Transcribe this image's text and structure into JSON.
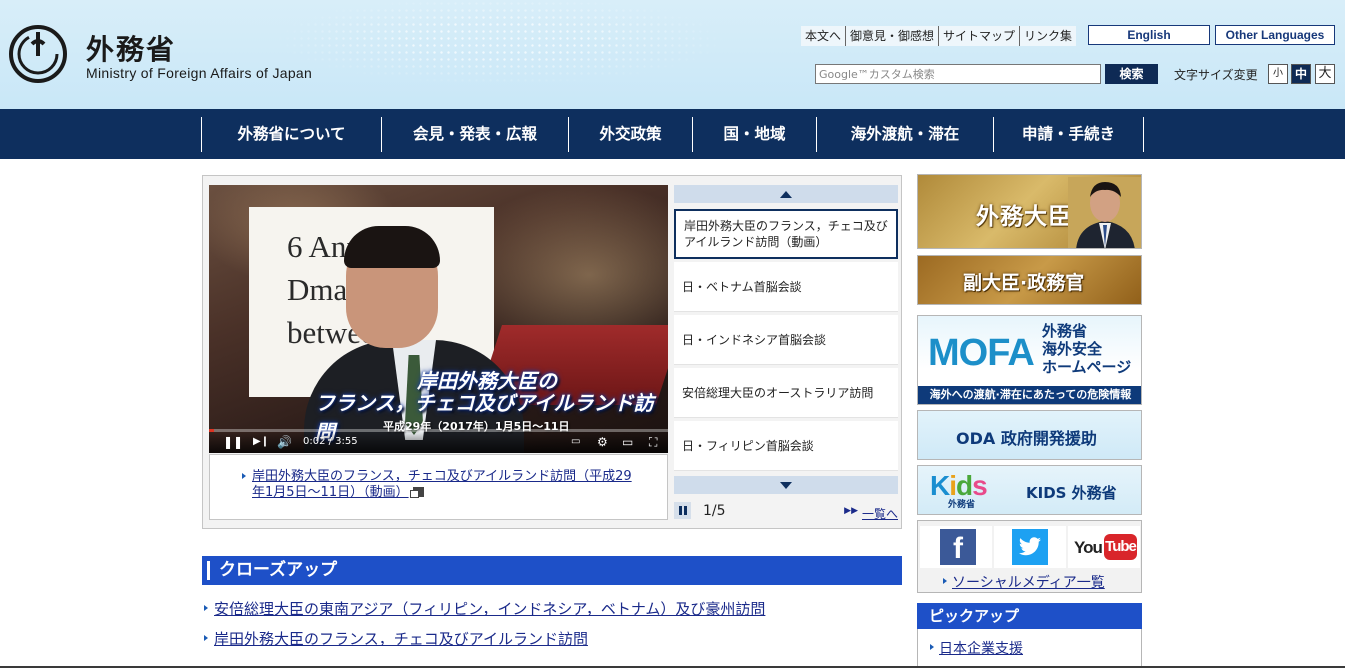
{
  "header": {
    "logo_jp": "外務省",
    "logo_en": "Ministry of Foreign Affairs of Japan",
    "util_links": [
      "本文へ",
      "御意見・御感想",
      "サイトマップ",
      "リンク集"
    ],
    "lang_english": "English",
    "lang_other": "Other Languages",
    "search_placeholder": "Google™カスタム検索",
    "search_button": "検索",
    "font_size_label": "文字サイズ変更",
    "font_sizes": [
      "小",
      "中",
      "大"
    ]
  },
  "nav": {
    "items": [
      "外務省について",
      "会見・発表・広報",
      "外交政策",
      "国・地域",
      "海外渡航・滞在",
      "申請・手続き"
    ]
  },
  "carousel": {
    "video": {
      "board_text": [
        "6 Anniver",
        "Dmatic R",
        "between"
      ],
      "caption_line1": "岸田外務大臣の",
      "caption_line2": "フランス，チェコ及びアイルランド訪問",
      "caption_date": "平成29年（2017年）1月5日～11日",
      "time": "0:02 / 3:55",
      "progress": 0.01
    },
    "video_link": "岸田外務大臣のフランス，チェコ及びアイルランド訪問（平成29年1月5日～11日）（動画）",
    "items": [
      "岸田外務大臣のフランス，チェコ及びアイルランド訪問（動画）",
      "日・ベトナム首脳会談",
      "日・インドネシア首脳会談",
      "安倍総理大臣のオーストラリア訪問",
      "日・フィリピン首脳会談"
    ],
    "pager": "1/5",
    "view_all": "一覧へ"
  },
  "closeup": {
    "title": "クローズアップ",
    "items": [
      "安倍総理大臣の東南アジア（フィリピン，インドネシア，ベトナム）及び豪州訪問",
      "岸田外務大臣のフランス，チェコ及びアイルランド訪問"
    ]
  },
  "sidebar": {
    "minister": "外務大臣",
    "vice": "副大臣·政務官",
    "mofa_logo": "MOFA",
    "mofa_title": [
      "外務省",
      "海外安全",
      "ホームページ"
    ],
    "mofa_strip": "海外への渡航·滞在にあたっての危険情報",
    "oda": "ODA 政府開発援助",
    "kids_sub": "外務省",
    "kids_title": "KIDS 外務省",
    "youtube_you": "You",
    "youtube_tube": "Tube",
    "social_link": "ソーシャルメディア一覧",
    "pickup_title": "ピックアップ",
    "pickup_items": [
      "日本企業支援"
    ]
  },
  "colors": {
    "nav_bg": "#0e2f5e",
    "section_head": "#1e50c8",
    "link": "#1a2a8a"
  }
}
